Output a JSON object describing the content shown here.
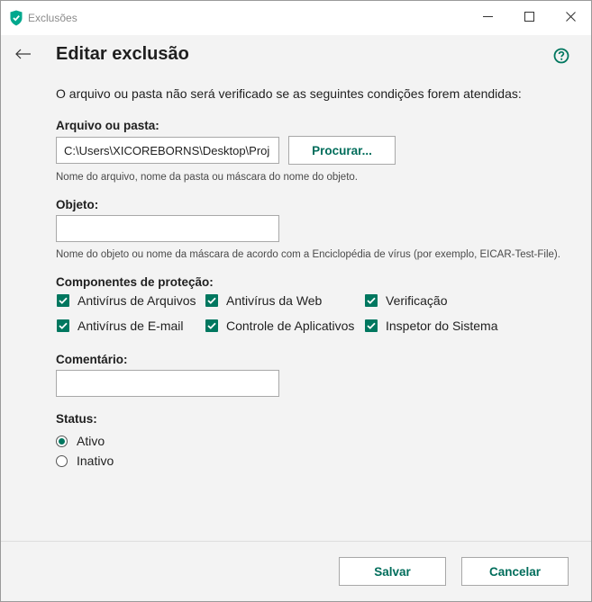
{
  "window": {
    "title": "Exclusões",
    "controls": [
      "minimize-icon",
      "maximize-icon",
      "close-icon"
    ]
  },
  "page": {
    "title": "Editar exclusão",
    "intro": "O arquivo ou pasta não será verificado se as seguintes condições forem atendidas:"
  },
  "file": {
    "label": "Arquivo ou pasta:",
    "value": "C:\\Users\\XICOREBORNS\\Desktop\\Proj",
    "browse_label": "Procurar...",
    "hint": "Nome do arquivo, nome da pasta ou máscara do nome do objeto."
  },
  "object": {
    "label": "Objeto:",
    "value": "",
    "hint": "Nome do objeto ou nome da máscara de acordo com a Enciclopédia de vírus (por exemplo, EICAR-Test-File)."
  },
  "components": {
    "label": "Componentes de proteção:",
    "items": [
      {
        "label": "Antivírus de Arquivos",
        "checked": true
      },
      {
        "label": "Antivírus da Web",
        "checked": true
      },
      {
        "label": "Verificação",
        "checked": true
      },
      {
        "label": "Antivírus de E-mail",
        "checked": true
      },
      {
        "label": "Controle de Aplicativos",
        "checked": true
      },
      {
        "label": "Inspetor do Sistema",
        "checked": true
      }
    ]
  },
  "comment": {
    "label": "Comentário:",
    "value": ""
  },
  "status": {
    "label": "Status:",
    "options": [
      {
        "label": "Ativo",
        "selected": true
      },
      {
        "label": "Inativo",
        "selected": false
      }
    ]
  },
  "footer": {
    "save_label": "Salvar",
    "cancel_label": "Cancelar"
  },
  "colors": {
    "accent": "#00775f",
    "accent_text": "#006d5b",
    "background": "#f3f3f3"
  }
}
